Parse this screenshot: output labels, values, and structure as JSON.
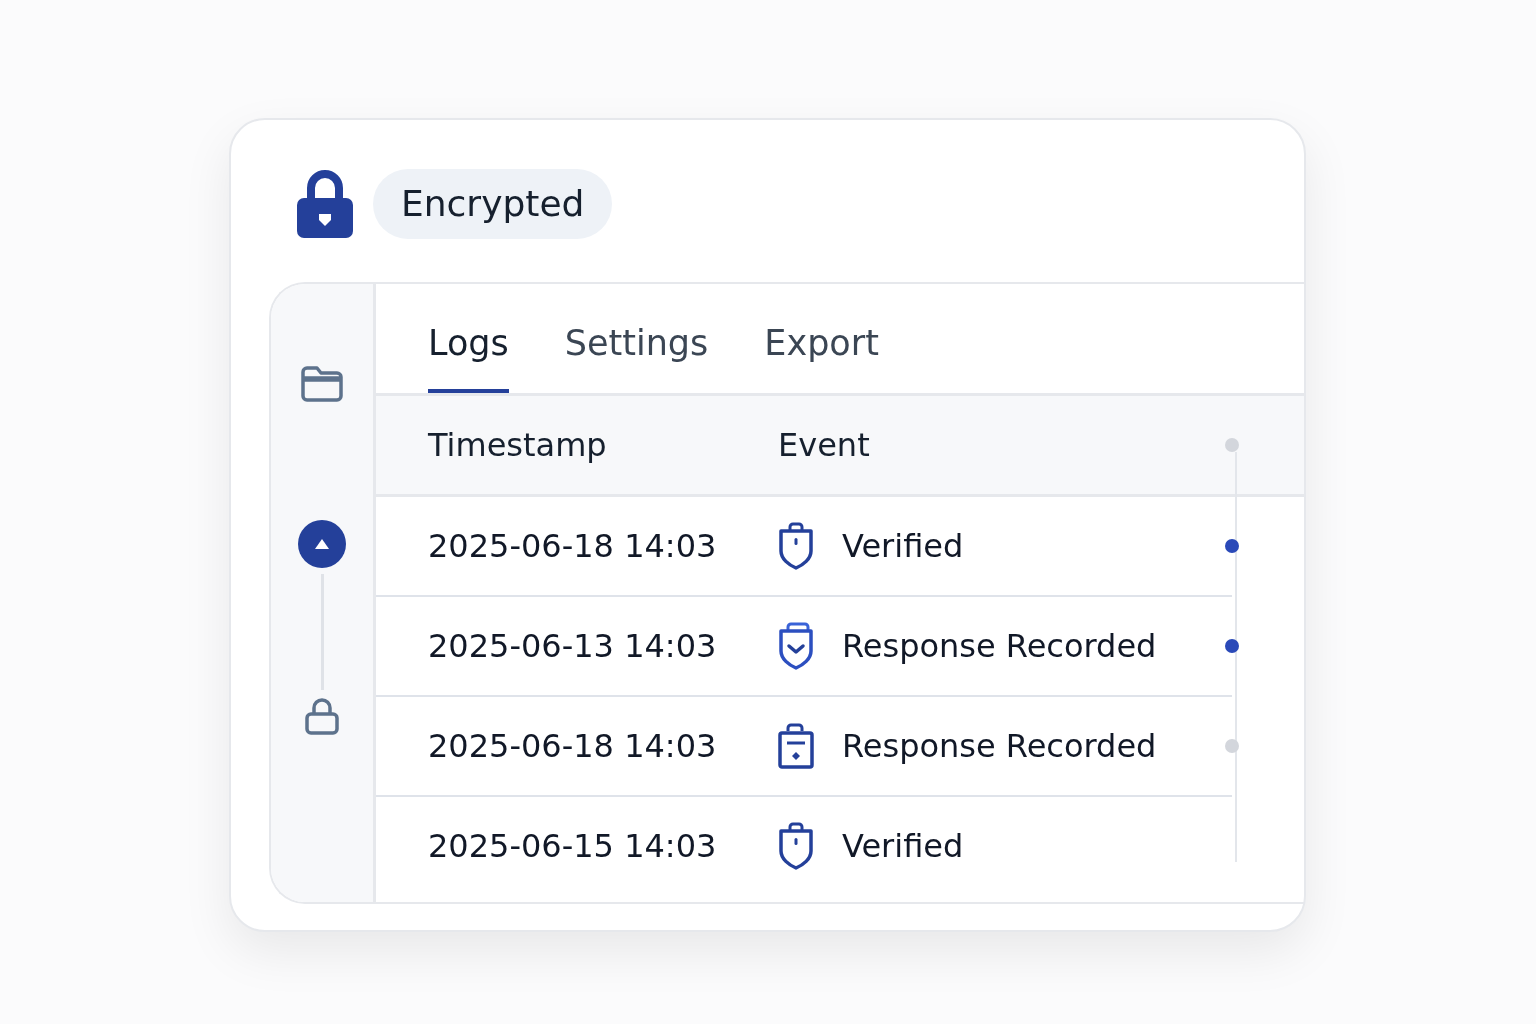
{
  "badge": {
    "label": "Encrypted"
  },
  "sidebar": {
    "items": [
      {
        "kind": "folder",
        "selected": false
      },
      {
        "kind": "up",
        "selected": true
      },
      {
        "kind": "lock",
        "selected": false
      }
    ]
  },
  "tabs": [
    {
      "label": "Logs",
      "selected": true
    },
    {
      "label": "Settings",
      "selected": false
    },
    {
      "label": "Export",
      "selected": false
    }
  ],
  "table": {
    "columns": [
      "Timestamp",
      "Event"
    ],
    "rows": [
      {
        "timestamp": "2025-06-18 14:03",
        "event": "Verified",
        "kind": "shield-lock",
        "active": true
      },
      {
        "timestamp": "2025-06-13 14:03",
        "event": "Response Recorded",
        "kind": "shield-check",
        "active": true
      },
      {
        "timestamp": "2025-06-18 14:03",
        "event": "Response Recorded",
        "kind": "clipboard",
        "active": false
      },
      {
        "timestamp": "2025-06-15 14:03",
        "event": "Verified",
        "kind": "shield-lock"
      }
    ]
  }
}
